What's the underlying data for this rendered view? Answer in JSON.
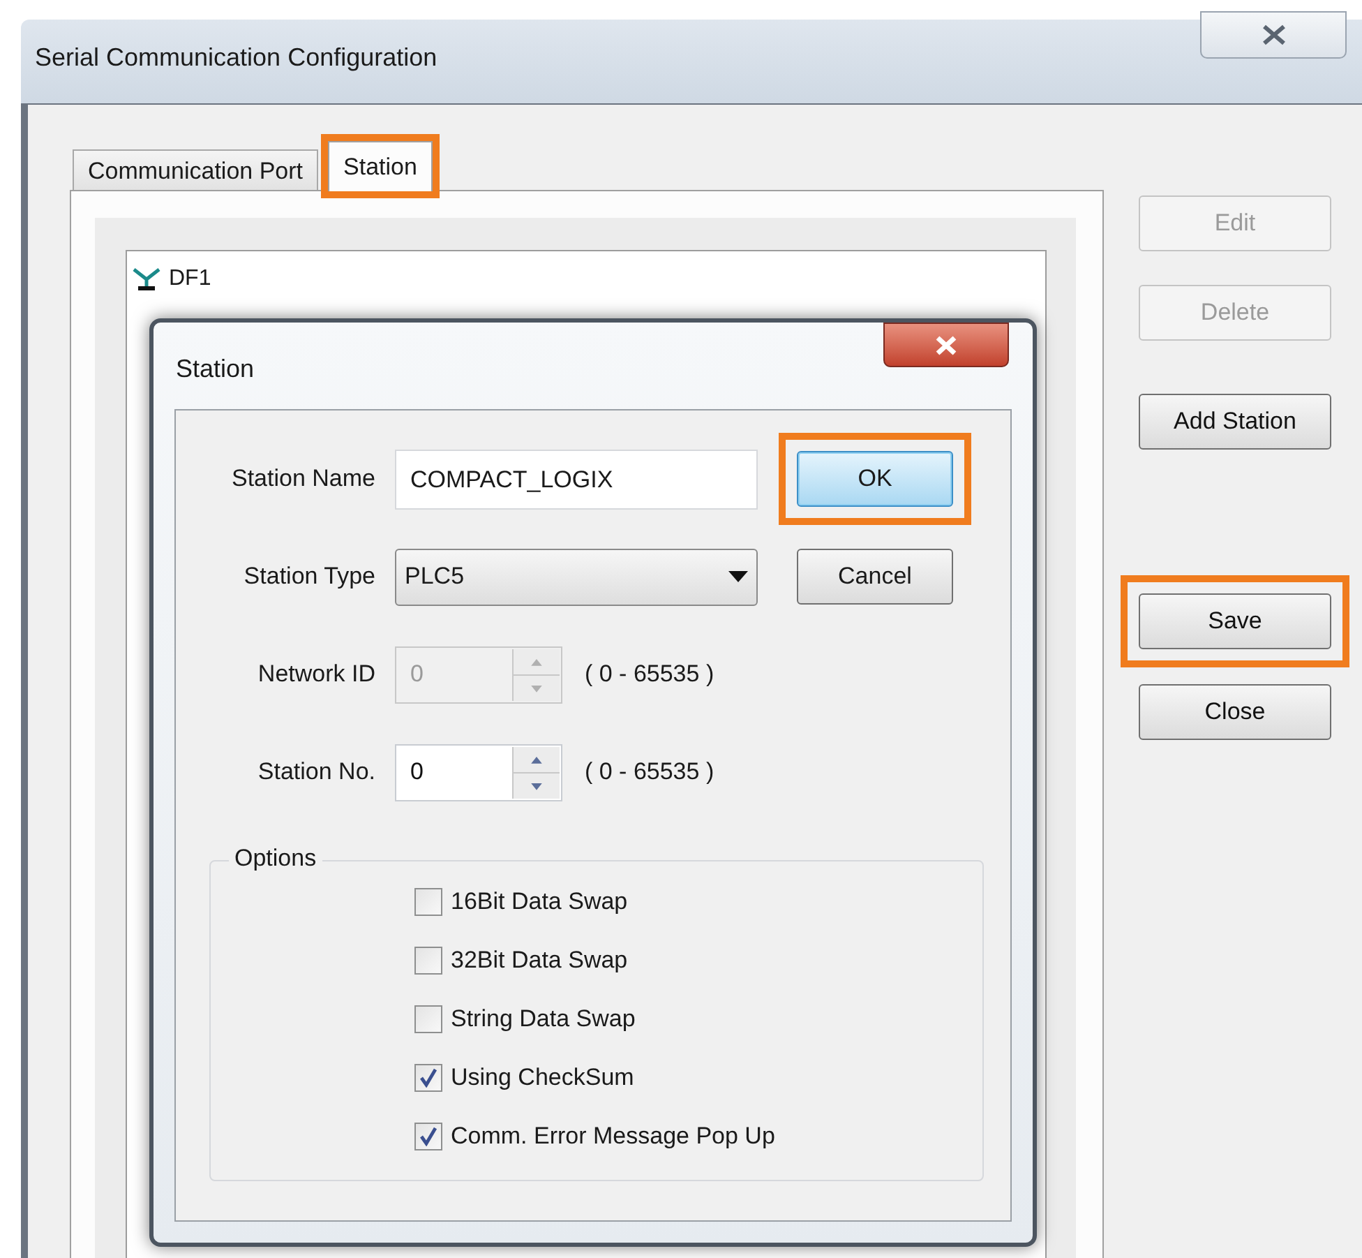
{
  "window": {
    "title": "Serial Communication Configuration"
  },
  "tabs": [
    {
      "label": "Communication Port",
      "selected": false,
      "highlighted": false
    },
    {
      "label": "Station",
      "selected": true,
      "highlighted": true
    }
  ],
  "tree": [
    {
      "label": "DF1"
    }
  ],
  "side_buttons": [
    {
      "label": "Edit",
      "disabled": true,
      "highlighted": false
    },
    {
      "label": "Delete",
      "disabled": true,
      "highlighted": false
    },
    {
      "label": "Add Station",
      "disabled": false,
      "highlighted": false
    },
    {
      "label": "Save",
      "disabled": false,
      "highlighted": true
    },
    {
      "label": "Close",
      "disabled": false,
      "highlighted": false
    }
  ],
  "dialog": {
    "title": "Station",
    "fields": [
      {
        "kind": "text",
        "label": "Station Name",
        "value": "COMPACT_LOGIX",
        "disabled": false
      },
      {
        "kind": "select",
        "label": "Station Type",
        "value": "PLC5",
        "disabled": false
      },
      {
        "kind": "spin",
        "label": "Network ID",
        "value": "0",
        "disabled": true,
        "range": "( 0 - 65535 )"
      },
      {
        "kind": "spin",
        "label": "Station No.",
        "value": "0",
        "disabled": false,
        "range": "( 0 - 65535 )"
      }
    ],
    "buttons": [
      {
        "label": "OK",
        "default": true,
        "highlighted": true
      },
      {
        "label": "Cancel",
        "default": false,
        "highlighted": false
      }
    ],
    "options": {
      "title": "Options",
      "items": [
        {
          "label": "16Bit Data Swap",
          "checked": false
        },
        {
          "label": "32Bit Data Swap",
          "checked": false
        },
        {
          "label": "String Data Swap",
          "checked": false
        },
        {
          "label": "Using CheckSum",
          "checked": true
        },
        {
          "label": "Comm. Error Message Pop Up",
          "checked": true
        }
      ]
    }
  }
}
